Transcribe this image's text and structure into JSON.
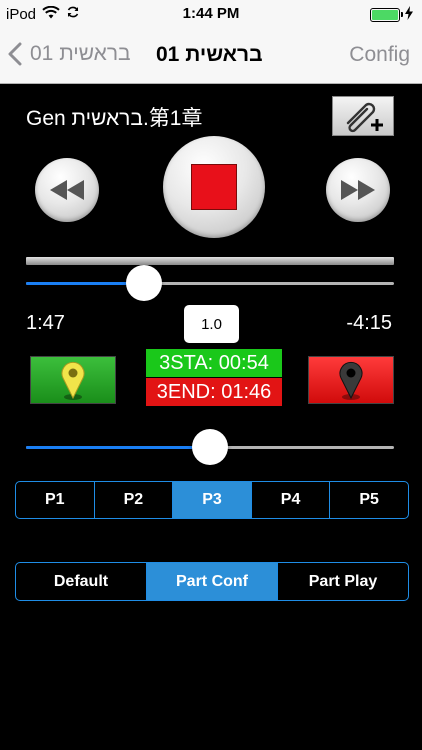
{
  "status_bar": {
    "carrier": "iPod",
    "time": "1:44 PM",
    "battery_percent": 100,
    "battery_color": "#4cd964"
  },
  "nav": {
    "back_label": "01 בראשית",
    "title": "01 בראשית",
    "config_label": "Config"
  },
  "player": {
    "track_title": "Gen בראשית.第1章",
    "elapsed": "1:47",
    "remaining": "-4:15",
    "speed": "1.0",
    "position_fraction": 0.32,
    "range_fraction": 0.5
  },
  "markers": {
    "start_label": "3STA: 00:54",
    "end_label": "3END: 01:46"
  },
  "parts": {
    "items": [
      "P1",
      "P2",
      "P3",
      "P4",
      "P5"
    ],
    "selected": "P3"
  },
  "modes": {
    "items": [
      "Default",
      "Part Conf",
      "Part Play"
    ],
    "selected": "Part Conf"
  },
  "colors": {
    "accent": "#2c8fd8",
    "start_marker": "#1ac81a",
    "end_marker": "#e21414",
    "stop": "#e8101a"
  },
  "icons": {
    "back": "chevron-left-icon",
    "attach": "paperclip-plus-icon",
    "rewind": "rewind-icon",
    "stop": "stop-icon",
    "fast_forward": "fast-forward-icon",
    "start_marker": "map-pin-icon",
    "end_marker": "map-pin-icon"
  }
}
